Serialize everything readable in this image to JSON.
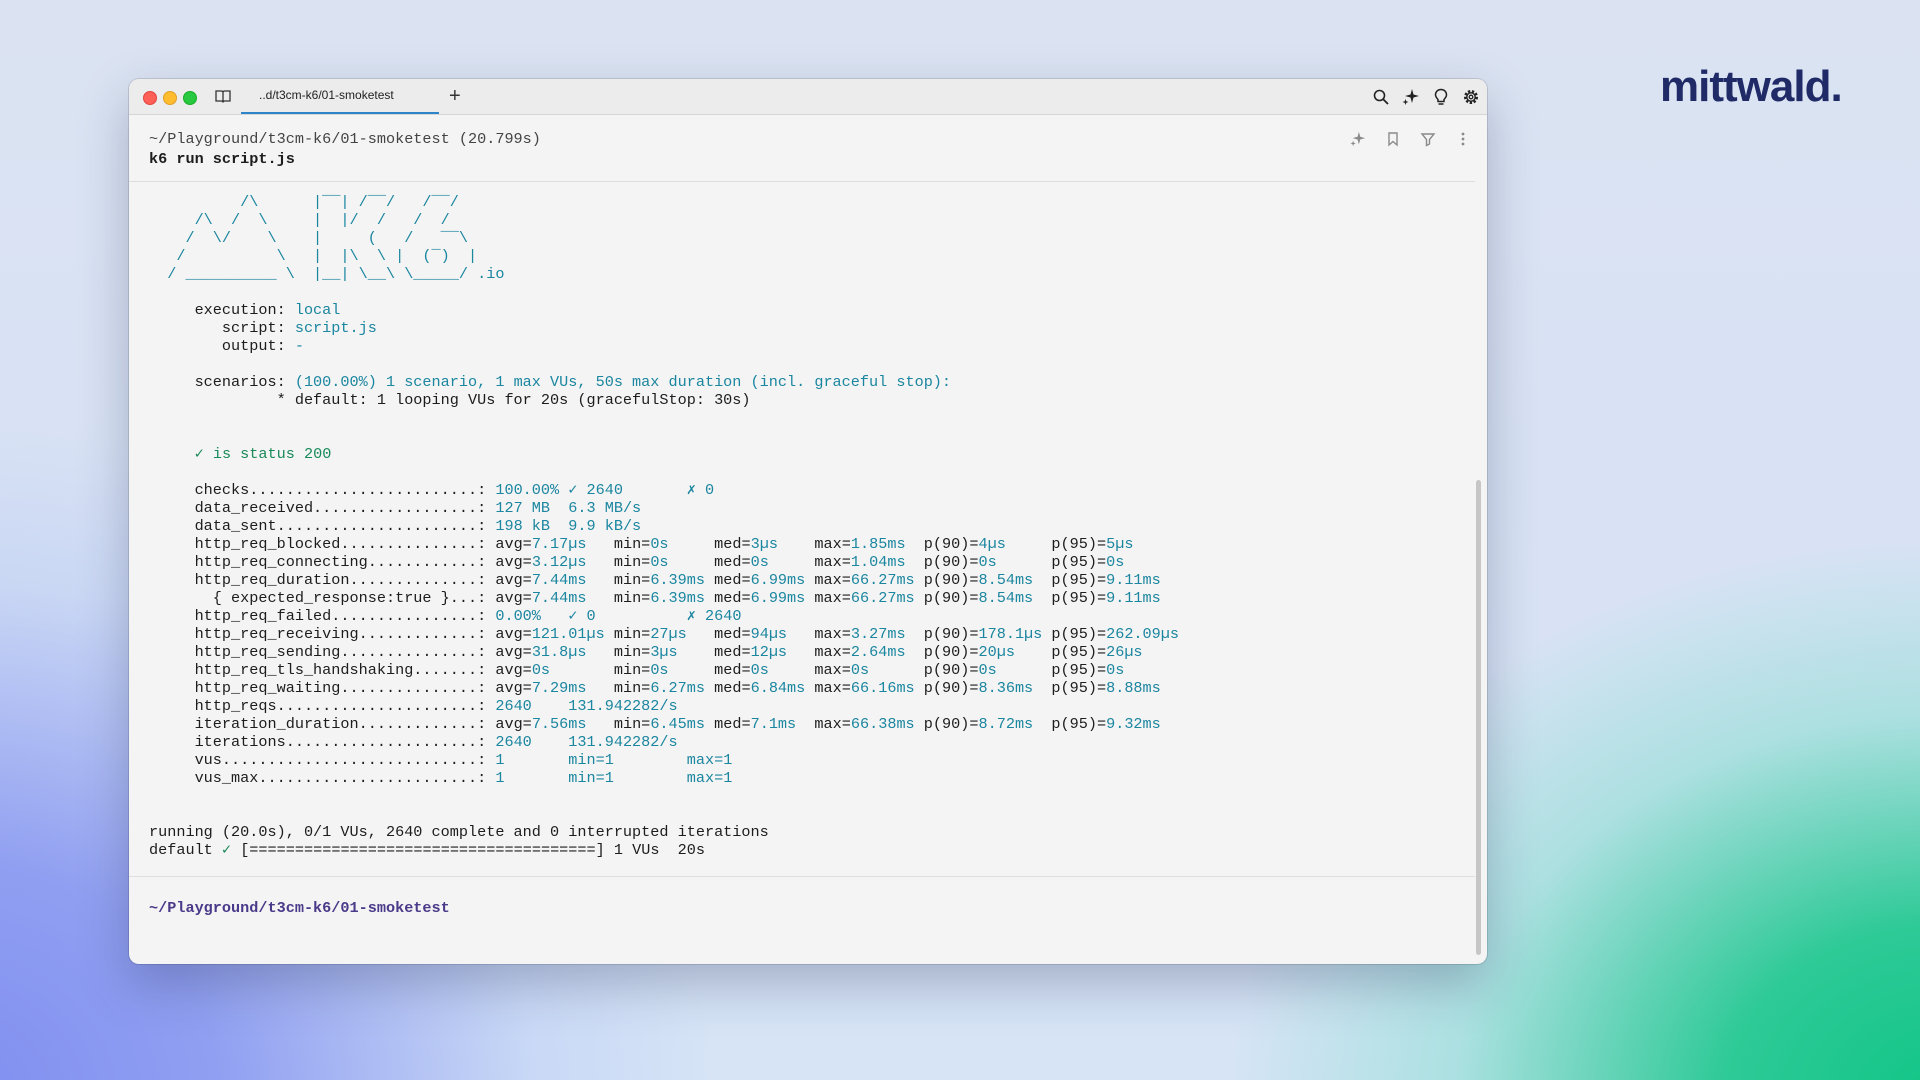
{
  "brand": {
    "logo_text": "mittwald."
  },
  "window": {
    "tab_title": "..d/t3cm-k6/01-smoketest",
    "new_tab_label": "+",
    "toolbar_icons": [
      "search-icon",
      "sparkle-icon",
      "lightbulb-icon",
      "gear-icon"
    ]
  },
  "block": {
    "path_line": "~/Playground/t3cm-k6/01-smoketest (20.799s)",
    "command": "k6 run script.js",
    "icons": [
      "sparkle-icon",
      "bookmark-icon",
      "filter-icon",
      "more-icon"
    ]
  },
  "banner": [
    "          /\\      |‾‾| /‾‾/   /‾‾/",
    "     /\\  /  \\     |  |/  /   /  /",
    "    /  \\/    \\    |     (   /   ‾‾\\",
    "   /          \\   |  |\\  \\ |  (‾)  |",
    "  / __________ \\  |__| \\__\\ \\_____/"
  ],
  "banner_suffix": " .io",
  "options": [
    {
      "label": "     execution: ",
      "value": "local"
    },
    {
      "label": "        script: ",
      "value": "script.js"
    },
    {
      "label": "        output: ",
      "value": "-"
    }
  ],
  "scenarios": {
    "label": "     scenarios: ",
    "summary": "(100.00%) 1 scenario, 1 max VUs, 50s max duration (incl. graceful stop):",
    "detail": "              * default: 1 looping VUs for 20s (gracefulStop: 30s)"
  },
  "check_line": "     ✓ is status 200",
  "metrics": [
    {
      "name": "     checks.........................: ",
      "cols": [
        [
          "",
          "100.00% ✓ 2640       ✗ 0"
        ]
      ]
    },
    {
      "name": "     data_received..................: ",
      "cols": [
        [
          "",
          "127 MB  6.3 MB/s"
        ]
      ]
    },
    {
      "name": "     data_sent......................: ",
      "cols": [
        [
          "",
          "198 kB  9.9 kB/s"
        ]
      ]
    },
    {
      "name": "     http_req_blocked...............: ",
      "cols": [
        [
          "avg=",
          "7.17µs   "
        ],
        [
          "min=",
          "0s     "
        ],
        [
          "med=",
          "3µs    "
        ],
        [
          "max=",
          "1.85ms  "
        ],
        [
          "p(90)=",
          "4µs     "
        ],
        [
          "p(95)=",
          "5µs"
        ]
      ]
    },
    {
      "name": "     http_req_connecting............: ",
      "cols": [
        [
          "avg=",
          "3.12µs   "
        ],
        [
          "min=",
          "0s     "
        ],
        [
          "med=",
          "0s     "
        ],
        [
          "max=",
          "1.04ms  "
        ],
        [
          "p(90)=",
          "0s      "
        ],
        [
          "p(95)=",
          "0s"
        ]
      ]
    },
    {
      "name": "     http_req_duration..............: ",
      "cols": [
        [
          "avg=",
          "7.44ms   "
        ],
        [
          "min=",
          "6.39ms "
        ],
        [
          "med=",
          "6.99ms "
        ],
        [
          "max=",
          "66.27ms "
        ],
        [
          "p(90)=",
          "8.54ms  "
        ],
        [
          "p(95)=",
          "9.11ms"
        ]
      ]
    },
    {
      "name": "       { expected_response:true }...: ",
      "cols": [
        [
          "avg=",
          "7.44ms   "
        ],
        [
          "min=",
          "6.39ms "
        ],
        [
          "med=",
          "6.99ms "
        ],
        [
          "max=",
          "66.27ms "
        ],
        [
          "p(90)=",
          "8.54ms  "
        ],
        [
          "p(95)=",
          "9.11ms"
        ]
      ]
    },
    {
      "name": "     http_req_failed................: ",
      "cols": [
        [
          "",
          "0.00%   ✓ 0          ✗ 2640"
        ]
      ]
    },
    {
      "name": "     http_req_receiving.............: ",
      "cols": [
        [
          "avg=",
          "121.01µs "
        ],
        [
          "min=",
          "27µs   "
        ],
        [
          "med=",
          "94µs   "
        ],
        [
          "max=",
          "3.27ms  "
        ],
        [
          "p(90)=",
          "178.1µs "
        ],
        [
          "p(95)=",
          "262.09µs"
        ]
      ]
    },
    {
      "name": "     http_req_sending...............: ",
      "cols": [
        [
          "avg=",
          "31.8µs   "
        ],
        [
          "min=",
          "3µs    "
        ],
        [
          "med=",
          "12µs   "
        ],
        [
          "max=",
          "2.64ms  "
        ],
        [
          "p(90)=",
          "20µs    "
        ],
        [
          "p(95)=",
          "26µs"
        ]
      ]
    },
    {
      "name": "     http_req_tls_handshaking.......: ",
      "cols": [
        [
          "avg=",
          "0s       "
        ],
        [
          "min=",
          "0s     "
        ],
        [
          "med=",
          "0s     "
        ],
        [
          "max=",
          "0s      "
        ],
        [
          "p(90)=",
          "0s      "
        ],
        [
          "p(95)=",
          "0s"
        ]
      ]
    },
    {
      "name": "     http_req_waiting...............: ",
      "cols": [
        [
          "avg=",
          "7.29ms   "
        ],
        [
          "min=",
          "6.27ms "
        ],
        [
          "med=",
          "6.84ms "
        ],
        [
          "max=",
          "66.16ms "
        ],
        [
          "p(90)=",
          "8.36ms  "
        ],
        [
          "p(95)=",
          "8.88ms"
        ]
      ]
    },
    {
      "name": "     http_reqs......................: ",
      "cols": [
        [
          "",
          "2640    131.942282/s"
        ]
      ]
    },
    {
      "name": "     iteration_duration.............: ",
      "cols": [
        [
          "avg=",
          "7.56ms   "
        ],
        [
          "min=",
          "6.45ms "
        ],
        [
          "med=",
          "7.1ms  "
        ],
        [
          "max=",
          "66.38ms "
        ],
        [
          "p(90)=",
          "8.72ms  "
        ],
        [
          "p(95)=",
          "9.32ms"
        ]
      ]
    },
    {
      "name": "     iterations.....................: ",
      "cols": [
        [
          "",
          "2640    131.942282/s"
        ]
      ]
    },
    {
      "name": "     vus............................: ",
      "cols": [
        [
          "",
          "1       min=1        max=1"
        ]
      ]
    },
    {
      "name": "     vus_max........................: ",
      "cols": [
        [
          "",
          "1       min=1        max=1"
        ]
      ]
    }
  ],
  "running_line": "running (20.0s), 0/1 VUs, 2640 complete and 0 interrupted iterations",
  "progress": {
    "name": "default ",
    "check": "✓",
    "bar": " [======================================] 1 VUs  20s",
    "value": 1.0
  },
  "prompt": "~/Playground/t3cm-k6/01-smoketest"
}
